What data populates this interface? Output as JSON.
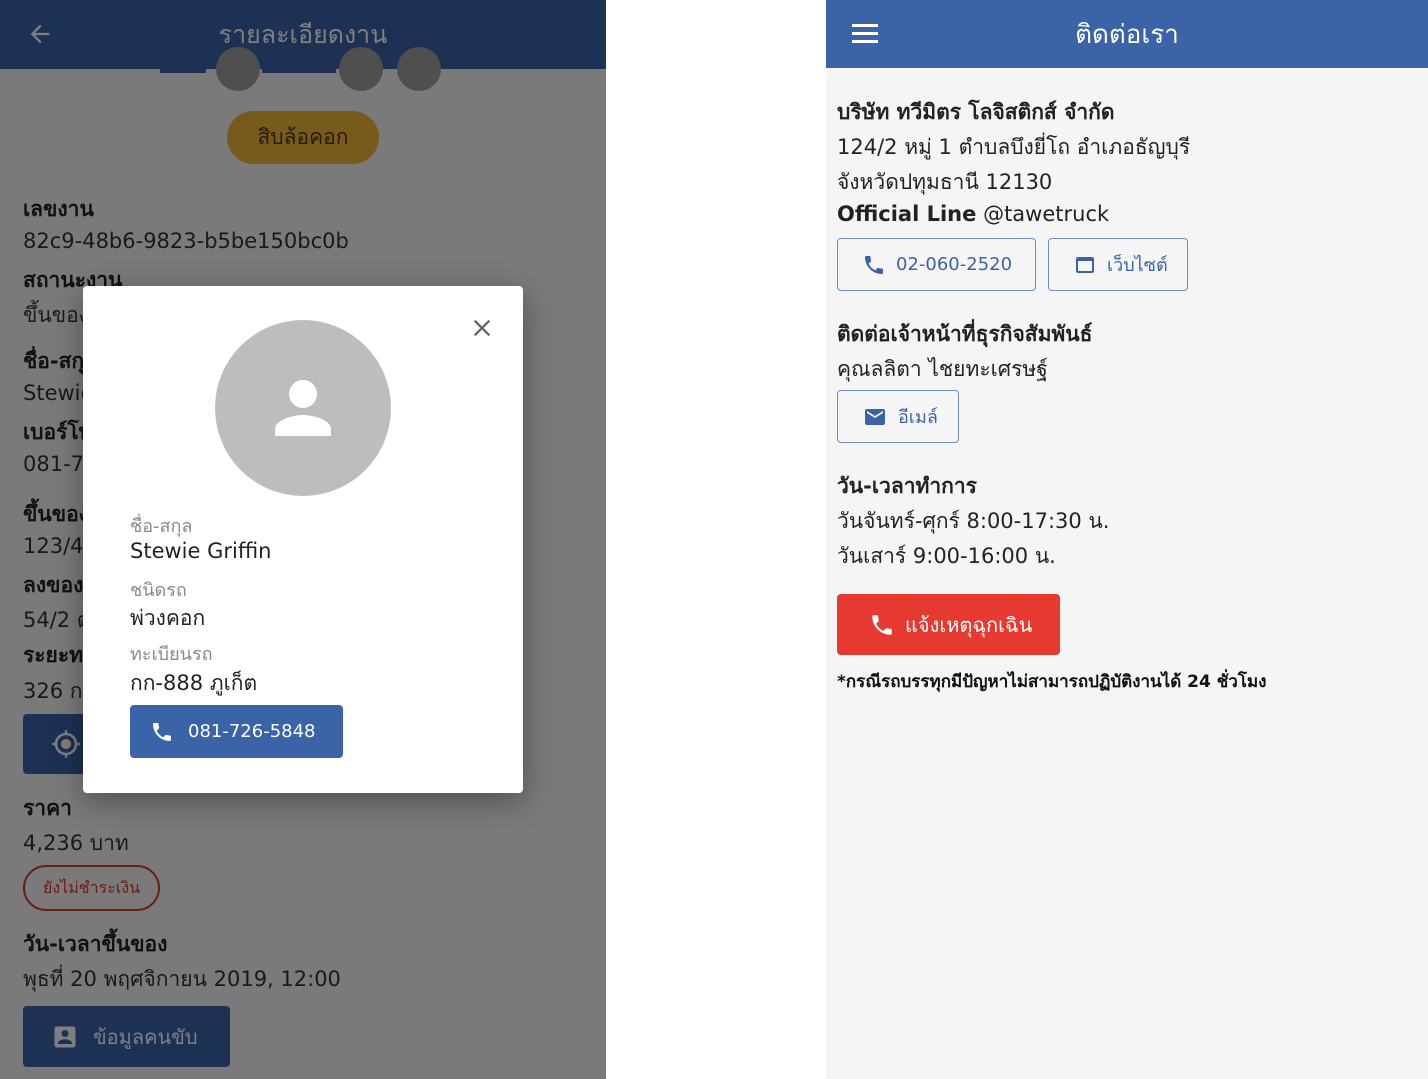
{
  "job_detail": {
    "title": "รายละเอียดงาน",
    "truck_type_chip": "สิบล้อคอก",
    "job_number_label": "เลขงาน",
    "job_number": "82c9-48b6-9823-b5be150bc0b",
    "status_label": "สถานะงาน",
    "status_value": "ขึ้นของ",
    "name_label": "ชื่อ-สกุ",
    "name_value": "Stewie",
    "phone_label": "เบอร์โท",
    "phone_value": "081-7",
    "pickup_label": "ขึ้นของ",
    "pickup_value": "123/4",
    "dropoff_label": "ลงของ",
    "dropoff_value": "54/2 ต",
    "distance_label": "ระยะท",
    "distance_value": "326 ก",
    "price_label": "ราคา",
    "price_value": "4,236 บาท",
    "payment_status": "ยังไม่ชำระเงิน",
    "pickup_time_label": "วัน-เวลาขึ้นของ",
    "pickup_time_value": "พุธที่ 20 พฤศจิกายน 2019, 12:00",
    "driver_info_button": "ข้อมูลคนขับ",
    "step_progress": 0.5
  },
  "driver_dialog": {
    "name_label": "ชื่อ-สกุล",
    "name_value": "Stewie Griffin",
    "vehicle_type_label": "ชนิดรถ",
    "vehicle_type_value": "พ่วงคอก",
    "plate_label": "ทะเบียนรถ",
    "plate_value": "กก-888 ภูเก็ต",
    "phone_button": "081-726-5848"
  },
  "contact": {
    "title": "ติดต่อเรา",
    "company_name": "บริษัท ทวีมิตร โลจิสติกส์ จำกัด",
    "address_line1": "124/2 หมู่ 1 ตำบลบึงยี่โถ อำเภอธัญบุรี",
    "address_line2": "จังหวัดปทุมธานี 12130",
    "official_line_label": "Official Line",
    "official_line_id": "@tawetruck",
    "phone_button": "02-060-2520",
    "website_button": "เว็บไซต์",
    "relations_heading": "ติดต่อเจ้าหน้าที่ธุรกิจสัมพันธ์",
    "relations_person": "คุณลลิตา ไชยทะเศรษฐ์",
    "email_button": "อีเมล์",
    "hours_heading": "วัน-เวลาทำการ",
    "hours_weekday": "วันจันทร์-ศุกร์ 8:00-17:30 น.",
    "hours_saturday": "วันเสาร์ 9:00-16:00 น.",
    "emergency_button": "แจ้งเหตุฉุกเฉิน",
    "emergency_note": "*กรณีรถบรรทุกมีปัญหาไม่สามารถปฏิบัติงานได้ 24 ชั่วโมง"
  },
  "colors": {
    "primary": "#3a63a8",
    "accent_chip": "#f3b43a",
    "danger": "#e6392f"
  }
}
